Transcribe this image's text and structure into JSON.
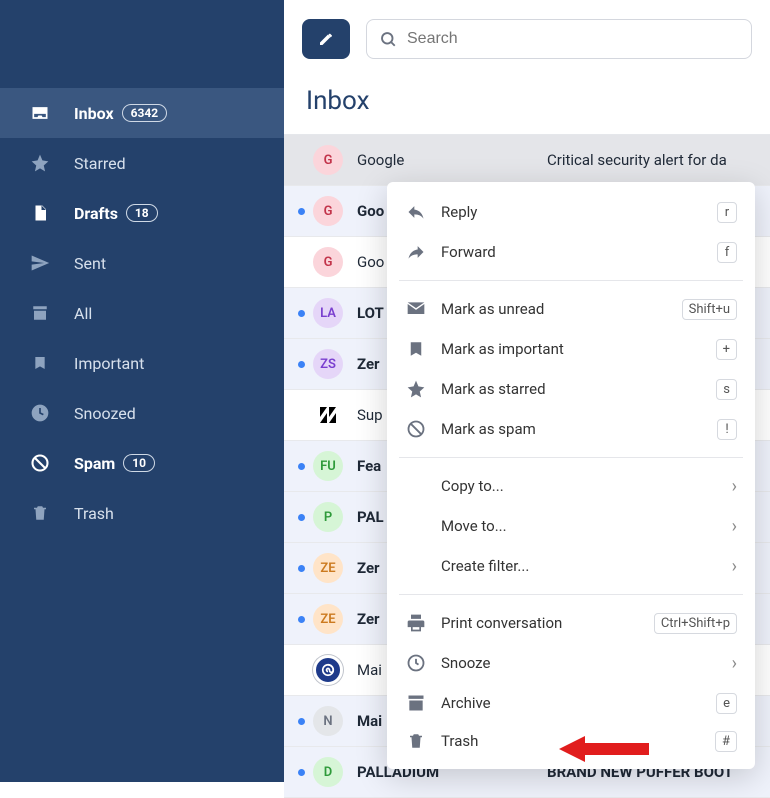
{
  "sidebar": {
    "items": [
      {
        "label": "Inbox",
        "count": "6342",
        "bold": true,
        "active": true,
        "icon": "inbox-icon"
      },
      {
        "label": "Starred",
        "icon": "star-icon"
      },
      {
        "label": "Drafts",
        "count": "18",
        "bold": true,
        "icon": "file-icon"
      },
      {
        "label": "Sent",
        "icon": "paper-plane-icon"
      },
      {
        "label": "All",
        "icon": "archive-box-icon"
      },
      {
        "label": "Important",
        "icon": "bookmark-icon"
      },
      {
        "label": "Snoozed",
        "icon": "clock-icon"
      },
      {
        "label": "Spam",
        "count": "10",
        "bold": true,
        "icon": "ban-icon"
      },
      {
        "label": "Trash",
        "icon": "trash-icon"
      }
    ]
  },
  "search": {
    "placeholder": "Search"
  },
  "page": {
    "title": "Inbox"
  },
  "emails": [
    {
      "dot": false,
      "avatar_text": "G",
      "avatar_bg": "#fbd5db",
      "avatar_fg": "#c2334a",
      "sender": "Google",
      "subject": "Critical security alert for da",
      "unread": false,
      "selected": true
    },
    {
      "dot": true,
      "avatar_text": "G",
      "avatar_bg": "#fbd5db",
      "avatar_fg": "#c2334a",
      "sender": "Goo",
      "subject": "",
      "unread": true
    },
    {
      "dot": false,
      "avatar_text": "G",
      "avatar_bg": "#fbd5db",
      "avatar_fg": "#c2334a",
      "sender": "Goo",
      "subject": "",
      "unread": false
    },
    {
      "dot": true,
      "avatar_text": "LA",
      "avatar_bg": "#e5d6f8",
      "avatar_fg": "#7a3fcf",
      "sender": "LOT",
      "subject": "",
      "unread": true
    },
    {
      "dot": true,
      "avatar_text": "ZS",
      "avatar_bg": "#e5d6f8",
      "avatar_fg": "#7a3fcf",
      "sender": "Zer",
      "subject": "",
      "unread": true
    },
    {
      "dot": false,
      "avatar_text": "Z",
      "avatar_bg": "#ffffff",
      "avatar_fg": "#000",
      "sender": "Sup",
      "subject": "",
      "unread": false,
      "zendesk": true
    },
    {
      "dot": true,
      "avatar_text": "FU",
      "avatar_bg": "#d6f5d6",
      "avatar_fg": "#2e9a3a",
      "sender": "Fea",
      "subject": "",
      "unread": true
    },
    {
      "dot": true,
      "avatar_text": "P",
      "avatar_bg": "#d6f5d6",
      "avatar_fg": "#2e9a3a",
      "sender": "PAL",
      "subject": "",
      "unread": true
    },
    {
      "dot": true,
      "avatar_text": "ZE",
      "avatar_bg": "#ffe4c8",
      "avatar_fg": "#cc7a1f",
      "sender": "Zer",
      "subject": "",
      "unread": true
    },
    {
      "dot": true,
      "avatar_text": "ZE",
      "avatar_bg": "#ffe4c8",
      "avatar_fg": "#cc7a1f",
      "sender": "Zer",
      "subject": "",
      "unread": true
    },
    {
      "dot": false,
      "avatar_text": "@",
      "avatar_bg": "#1e3a8a",
      "avatar_fg": "#fff",
      "sender": "Mai",
      "subject": "",
      "unread": false,
      "circle_icon": true
    },
    {
      "dot": true,
      "avatar_text": "N",
      "avatar_bg": "#e4e6e9",
      "avatar_fg": "#6b7280",
      "sender": "Mai",
      "subject": "",
      "unread": true
    },
    {
      "dot": true,
      "avatar_text": "D",
      "avatar_bg": "#d6f5d6",
      "avatar_fg": "#2e9a3a",
      "sender": "PALLADIUM",
      "subject": "BRAND NEW PUFFER BOOT",
      "unread": true
    }
  ],
  "menu": {
    "reply": "Reply",
    "reply_key": "r",
    "forward": "Forward",
    "forward_key": "f",
    "unread": "Mark as unread",
    "unread_key": "Shift+u",
    "important": "Mark as important",
    "important_key": "+",
    "starred": "Mark as starred",
    "starred_key": "s",
    "spam": "Mark as spam",
    "spam_key": "!",
    "copy": "Copy to...",
    "move": "Move to...",
    "filter": "Create filter...",
    "print": "Print conversation",
    "print_key": "Ctrl+Shift+p",
    "snooze": "Snooze",
    "archive": "Archive",
    "archive_key": "e",
    "trash": "Trash",
    "trash_key": "#"
  }
}
